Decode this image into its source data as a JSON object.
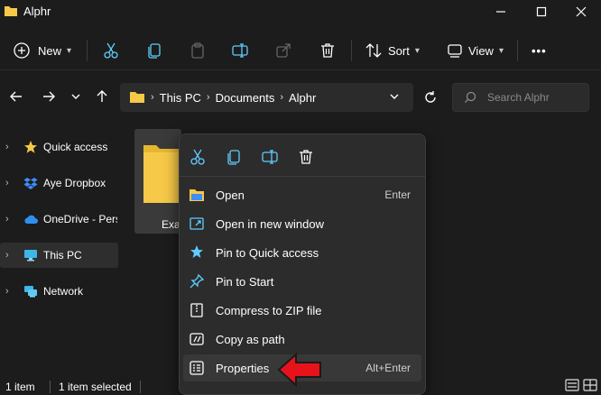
{
  "window": {
    "title": "Alphr"
  },
  "toolbar": {
    "new_label": "New",
    "sort_label": "Sort",
    "view_label": "View",
    "more_label": "•••"
  },
  "address": {
    "segments": [
      "This PC",
      "Documents",
      "Alphr"
    ]
  },
  "search": {
    "placeholder": "Search Alphr"
  },
  "sidebar": {
    "items": [
      {
        "label": "Quick access",
        "icon": "star-icon"
      },
      {
        "label": "Aye Dropbox",
        "icon": "dropbox-icon"
      },
      {
        "label": "OneDrive - Pers",
        "icon": "onedrive-cloud-icon"
      },
      {
        "label": "This PC",
        "icon": "monitor-icon",
        "selected": true
      },
      {
        "label": "Network",
        "icon": "network-icon"
      }
    ]
  },
  "content": {
    "folder_label": "Exa"
  },
  "context_menu": {
    "items": [
      {
        "label": "Open",
        "shortcut": "Enter",
        "icon": "folder-open-icon"
      },
      {
        "label": "Open in new window",
        "shortcut": "",
        "icon": "new-window-icon"
      },
      {
        "label": "Pin to Quick access",
        "shortcut": "",
        "icon": "pin-icon"
      },
      {
        "label": "Pin to Start",
        "shortcut": "",
        "icon": "pin-start-icon"
      },
      {
        "label": "Compress to ZIP file",
        "shortcut": "",
        "icon": "zip-icon"
      },
      {
        "label": "Copy as path",
        "shortcut": "",
        "icon": "copy-path-icon"
      },
      {
        "label": "Properties",
        "shortcut": "Alt+Enter",
        "icon": "properties-icon"
      }
    ]
  },
  "status": {
    "item_count": "1 item",
    "selected": "1 item selected"
  },
  "colors": {
    "accent": "#60cdff",
    "folder": "#f7c948",
    "arrow": "#e8121a"
  }
}
